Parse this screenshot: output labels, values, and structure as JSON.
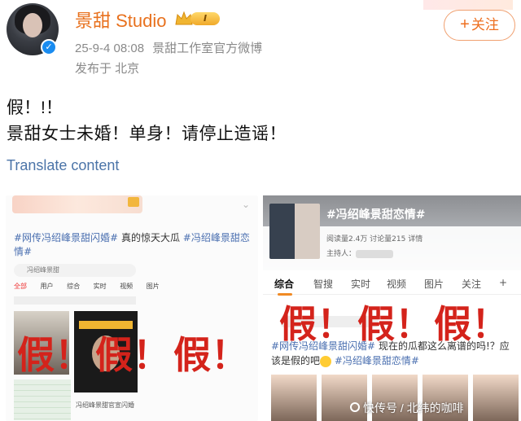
{
  "post": {
    "author": "景甜 Studio",
    "level_badge": "I",
    "timestamp": "25-9-4 08:08",
    "source": "景甜工作室官方微博",
    "location": "发布于 北京",
    "follow_label": "关注",
    "follow_icon": "+",
    "verified_icon": "✓",
    "line1": "假！!！",
    "line2": "景甜女士未婚！单身！请停止造谣！",
    "translate_label": "Translate content"
  },
  "image_left": {
    "hashtag1": "#网传冯绍峰景甜闪婚#",
    "plain": " 真的惊天大瓜 ",
    "hashtag2": "#冯绍峰景甜恋情#",
    "search_text": "冯绍峰景甜",
    "nav": [
      "全部",
      "用户",
      "综合",
      "实时",
      "视频",
      "图片"
    ],
    "caption": "冯绍峰景甜官宣闪婚",
    "stamps": [
      "假！",
      "假！",
      "假！"
    ]
  },
  "image_right": {
    "topic_title": "#冯绍峰景甜恋情#",
    "stats": "阅读量2.4万  讨论量215  详情",
    "host_label": "主持人：",
    "tabs": [
      "综合",
      "智搜",
      "实时",
      "视频",
      "图片",
      "关注"
    ],
    "tabs_more": "+",
    "post_hashtag1": "#网传冯绍峰景甜闪婚#",
    "post_text": " 现在的瓜都这么离谱的吗!？应该是假的吧",
    "post_hashtag2": "#冯绍峰景甜恋情#",
    "stamps": [
      "假！",
      "假！",
      "假！"
    ]
  },
  "watermark": "快传号 / 北纬的咖啡"
}
